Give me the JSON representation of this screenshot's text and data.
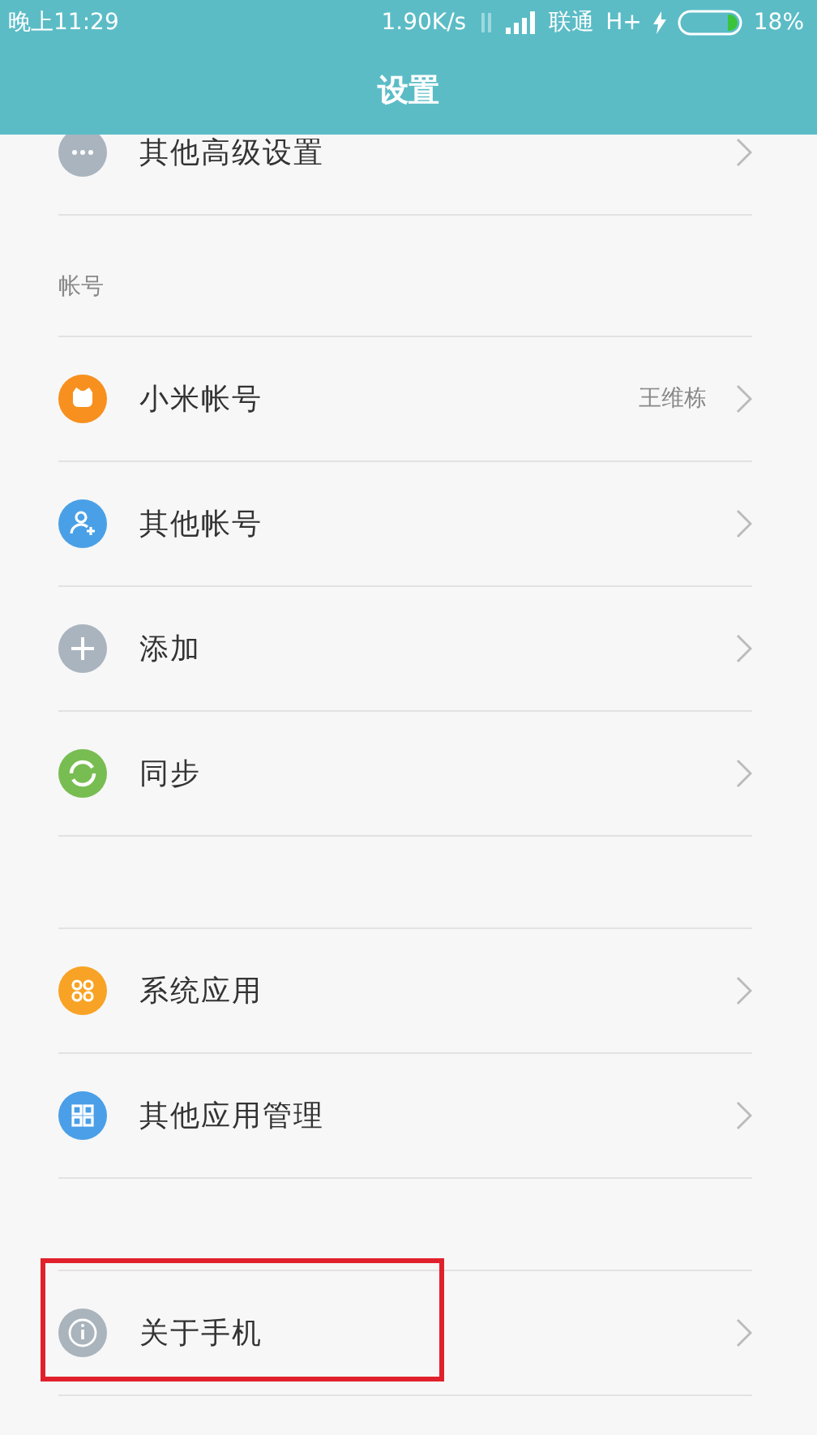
{
  "status_bar": {
    "time": "晚上11:29",
    "speed": "1.90K/s",
    "carrier": "联通",
    "network": "H+",
    "charging": true,
    "battery": "18%"
  },
  "title": "设置",
  "sections": [
    {
      "items": [
        {
          "kind": "more",
          "color": "#a9b4bf",
          "label": "其他高级设置",
          "highlighted": false
        }
      ]
    },
    {
      "header": "帐号",
      "items": [
        {
          "kind": "mi",
          "color": "#f7901e",
          "label": "小米帐号",
          "value": "王维栋",
          "highlighted": false
        },
        {
          "kind": "person-add",
          "color": "#4aa0e6",
          "label": "其他帐号",
          "highlighted": false
        },
        {
          "kind": "plus",
          "color": "#a9b4bf",
          "label": "添加",
          "highlighted": false
        },
        {
          "kind": "sync",
          "color": "#78bd52",
          "label": "同步",
          "highlighted": false
        }
      ]
    },
    {
      "items": [
        {
          "kind": "circles",
          "color": "#f8a325",
          "label": "系统应用",
          "highlighted": false
        },
        {
          "kind": "squares",
          "color": "#4a9fe8",
          "label": "其他应用管理",
          "highlighted": false
        }
      ]
    },
    {
      "items": [
        {
          "kind": "info",
          "color": "#aab4bd",
          "label": "关于手机",
          "highlighted": true
        }
      ]
    }
  ]
}
